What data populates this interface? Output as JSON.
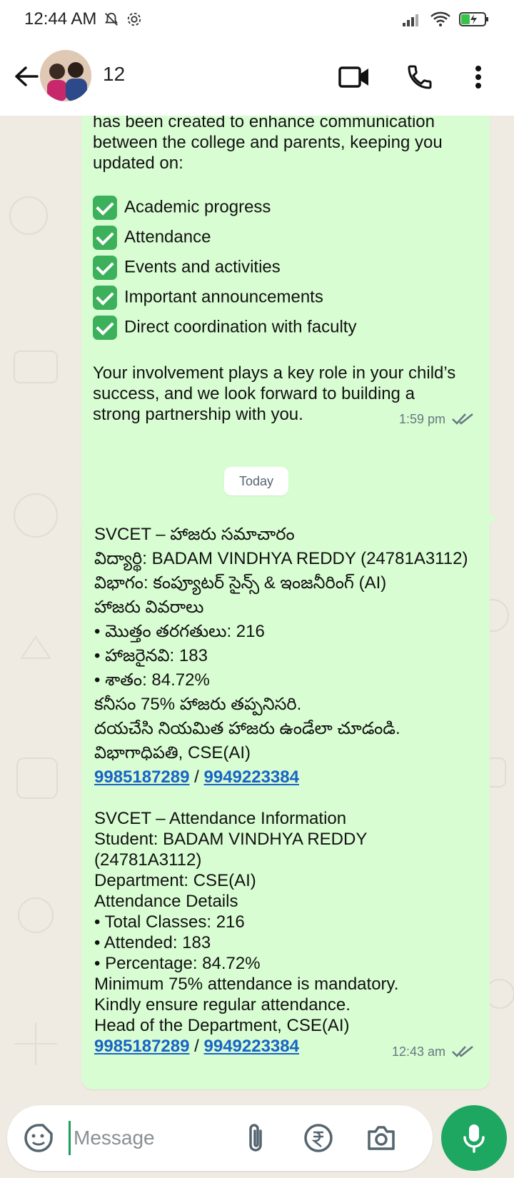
{
  "status_bar": {
    "time": "12:44 AM"
  },
  "header": {
    "contact_name": "12"
  },
  "messages": [
    {
      "intro_lines": [
        "has been created to enhance communication",
        "between the college and parents, keeping you",
        "updated on:"
      ],
      "checklist": [
        "Academic progress",
        "Attendance",
        "Events and activities",
        "Important announcements",
        "Direct coordination with faculty"
      ],
      "closing_lines": [
        "Your involvement plays a key role in your child’s",
        "success, and we look forward to building a",
        "strong partnership with you."
      ],
      "time": "1:59 pm"
    },
    {
      "telugu_lines": [
        "SVCET – హాజరు సమాచారం",
        "విద్యార్థి: BADAM VINDHYA REDDY (24781A3112)",
        "విభాగం: కంప్యూటర్ సైన్స్ & ఇంజనీరింగ్ (AI)",
        "హాజరు వివరాలు",
        "•  మొత్తం తరగతులు: 216",
        "•  హాజరైనవి: 183",
        "•  శాతం: 84.72%",
        "కనీసం 75% హాజరు తప్పనిసరి.",
        "దయచేసి నియమిత హాజరు ఉండేలా చూడండి.",
        "విభాగాధిపతి, CSE(AI)"
      ],
      "english_lines": [
        "SVCET – Attendance Information",
        "Student: BADAM VINDHYA REDDY",
        "(24781A3112)",
        "Department: CSE(AI)",
        "Attendance Details",
        "•  Total Classes: 216",
        "•  Attended: 183",
        "•  Percentage: 84.72%",
        "Minimum 75% attendance is mandatory.",
        "Kindly ensure regular attendance.",
        "Head of the Department, CSE(AI)"
      ],
      "phone_1": "9985187289",
      "phone_2": "9949223384",
      "separator": "/",
      "time": "12:43 am"
    }
  ],
  "date_chip": "Today",
  "composer": {
    "placeholder": "Message"
  },
  "colors": {
    "bubble_out": "#d9fdd3",
    "accent": "#1da760",
    "link": "#1764c4",
    "background": "#efeae2"
  }
}
